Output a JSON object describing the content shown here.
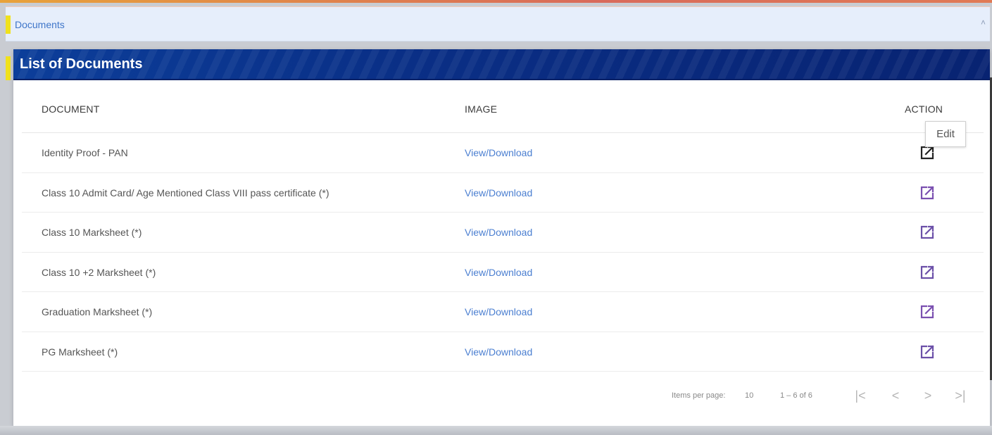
{
  "breadcrumb": {
    "label": "Documents"
  },
  "panel": {
    "title": "List of Documents"
  },
  "table": {
    "headers": {
      "document": "DOCUMENT",
      "image": "IMAGE",
      "action": "ACTION"
    },
    "rows": [
      {
        "document": "Identity Proof - PAN",
        "link": "View/Download",
        "icon": "edit-icon",
        "icon_color": "#222222"
      },
      {
        "document": "Class 10 Admit Card/ Age Mentioned Class VIII pass certificate (*)",
        "link": "View/Download",
        "icon": "edit-icon",
        "icon_color": "#7a4fb0"
      },
      {
        "document": "Class 10 Marksheet (*)",
        "link": "View/Download",
        "icon": "edit-icon",
        "icon_color": "#6b4fa8"
      },
      {
        "document": "Class 10 +2 Marksheet (*)",
        "link": "View/Download",
        "icon": "edit-icon",
        "icon_color": "#6b4fa8"
      },
      {
        "document": "Graduation Marksheet (*)",
        "link": "View/Download",
        "icon": "edit-icon",
        "icon_color": "#7a4fb0"
      },
      {
        "document": "PG Marksheet (*)",
        "link": "View/Download",
        "icon": "edit-icon",
        "icon_color": "#6b4fa8"
      }
    ]
  },
  "tooltip": {
    "text": "Edit"
  },
  "paginator": {
    "items_per_page_label": "Items per page:",
    "page_size": "10",
    "range_label": "1 – 6 of 6",
    "first": "|<",
    "prev": "<",
    "next": ">",
    "last": ">|"
  },
  "colors": {
    "header_bar": "#0a2f86",
    "link": "#4b7fd1",
    "breadcrumb_bg": "#e6eefb"
  }
}
